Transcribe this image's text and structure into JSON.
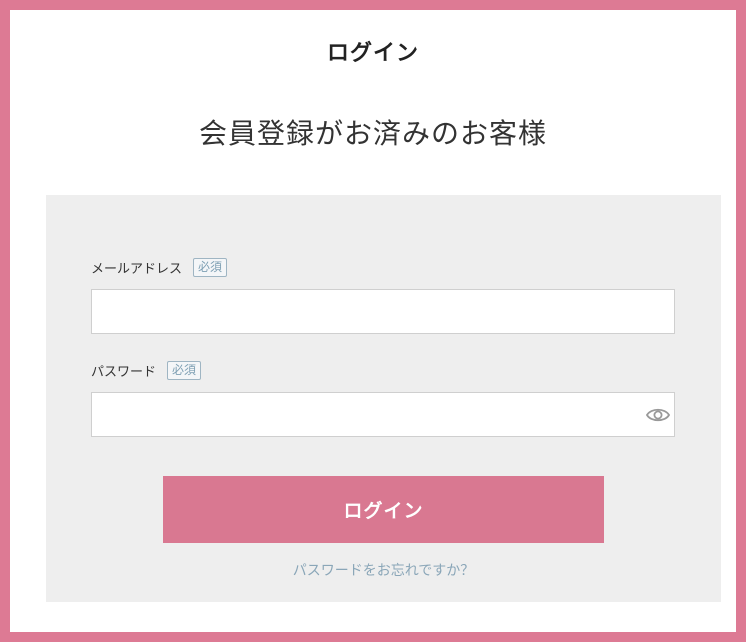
{
  "page": {
    "title": "ログイン",
    "subtitle": "会員登録がお済みのお客様"
  },
  "form": {
    "email": {
      "label": "メールアドレス",
      "required": "必須",
      "value": ""
    },
    "password": {
      "label": "パスワード",
      "required": "必須",
      "value": "",
      "toggle_icon": "eye-icon"
    },
    "submit_label": "ログイン",
    "forgot_label": "パスワードをお忘れですか？"
  },
  "colors": {
    "accent": "#d97891",
    "frame": "#dd7a94",
    "panel": "#eeeeee",
    "link": "#8aa6b8"
  }
}
